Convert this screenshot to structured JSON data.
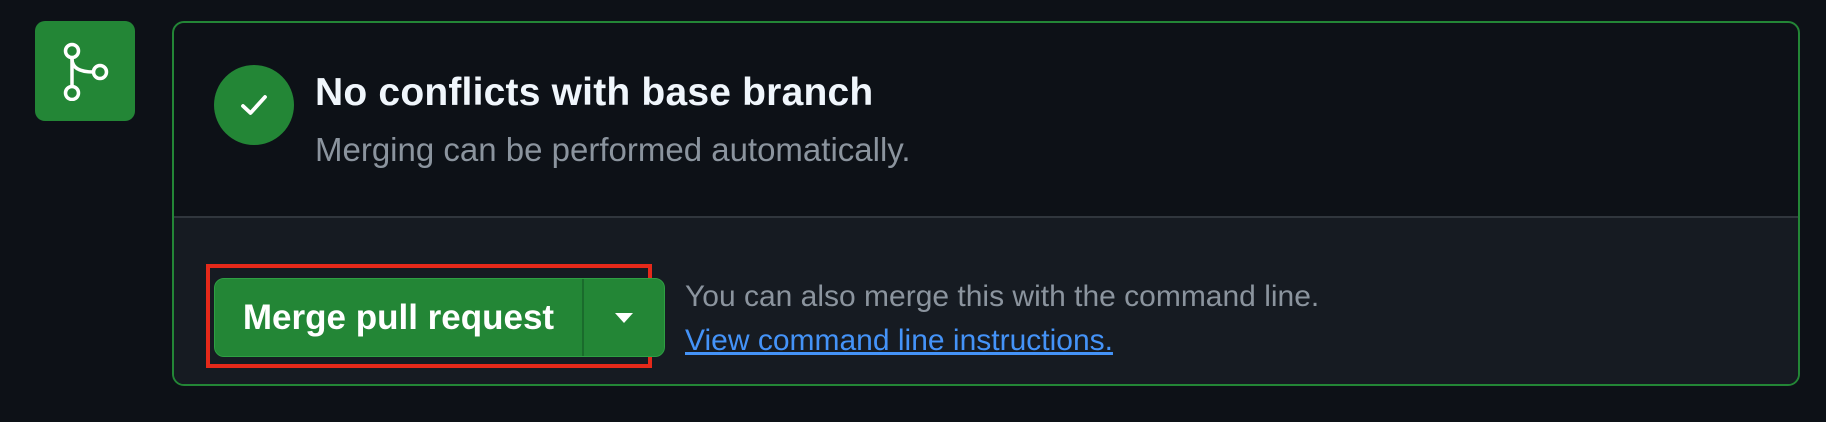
{
  "icons": {
    "merge": "git-merge-icon",
    "check": "check-icon",
    "dropdown": "triangle-down-icon"
  },
  "status": {
    "title": "No conflicts with base branch",
    "subtitle": "Merging can be performed automatically."
  },
  "actions": {
    "merge_button_label": "Merge pull request",
    "cmdline_text": "You can also merge this with the command line.",
    "cmdline_link": "View command line instructions."
  },
  "colors": {
    "background": "#0d1117",
    "panel": "#161b22",
    "success": "#238636",
    "border_muted": "#30363d",
    "text_primary": "#f0f6fc",
    "text_muted": "#8b949e",
    "link": "#4493f8",
    "highlight": "#e5291a"
  }
}
